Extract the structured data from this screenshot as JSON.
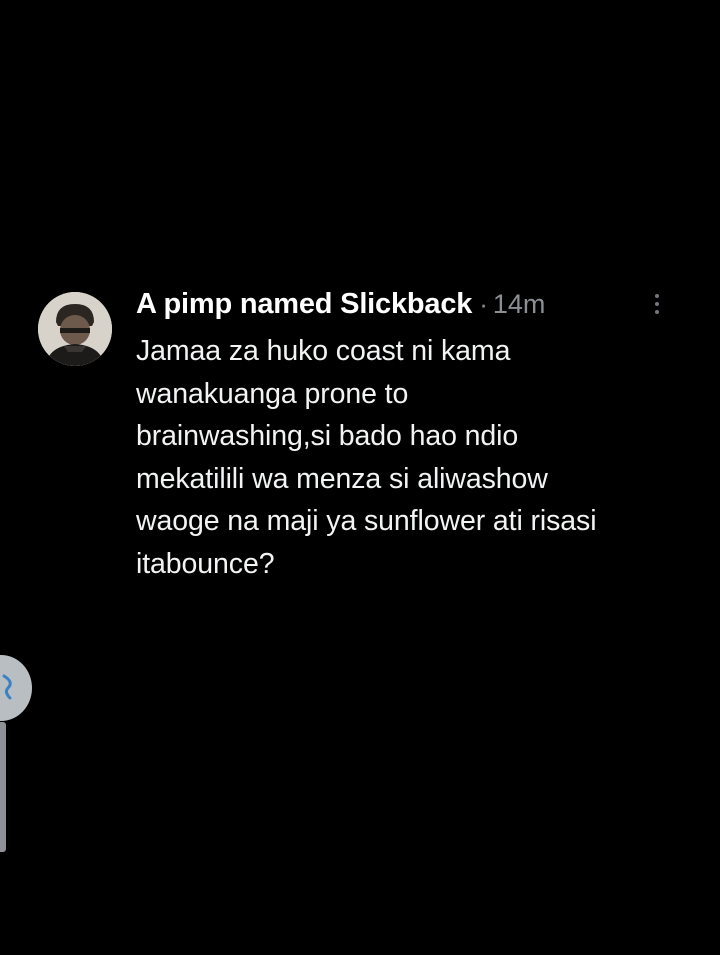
{
  "tweet": {
    "display_name": "A pimp named Slickback",
    "separator": "·",
    "timestamp": "14m",
    "text": "Jamaa za huko coast ni kama\nwanakuanga prone to\nbrainwashing,si bado hao ndio\nmekatilili wa menza si aliwashow\nwaoge na maji ya sunflower ati risasi\nitabounce?",
    "avatar_icon": "user-avatar-photo",
    "more_icon": "vertical-ellipsis-icon"
  },
  "overlay": {
    "bubble_icon": "floating-bubble-icon",
    "colors": {
      "background": "#000000",
      "name": "#ffffff",
      "meta": "#8b8f93",
      "body": "#f2f3f4",
      "bubble": "#b9bec2",
      "bubble_glyph": "#3b82c4"
    }
  }
}
